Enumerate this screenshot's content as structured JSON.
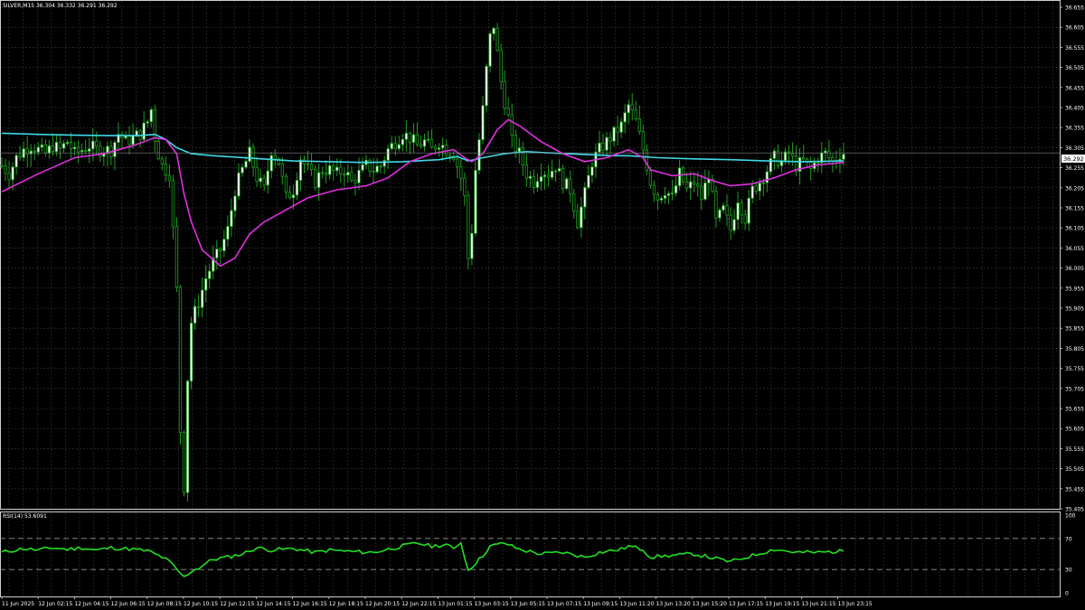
{
  "header": {
    "symbol_line": "SILVER,M15  36.304 36.332 36.291 36.292"
  },
  "rsi_header": {
    "label": "RSI(14) 53.6091"
  },
  "current_price_tag": "36.292",
  "colors": {
    "background": "#000000",
    "grid": "#3a3a3a",
    "axis_text": "#ffffff",
    "bull_candle": "#ffffff",
    "bear_candle": "#000000",
    "candle_outline": "#1f9d1f",
    "ma_fast": "#e030e0",
    "ma_slow": "#40d8e8",
    "rsi_line": "#22e022",
    "level_line": "#9a9a9a"
  },
  "chart_data": [
    {
      "type": "candlestick",
      "title": "SILVER,M15",
      "ylim": [
        35.405,
        36.655
      ],
      "y_ticks": [
        "36.655",
        "36.605",
        "36.555",
        "36.505",
        "36.455",
        "36.405",
        "36.355",
        "36.305",
        "36.255",
        "36.205",
        "36.155",
        "36.105",
        "36.055",
        "36.005",
        "35.955",
        "35.905",
        "35.855",
        "35.805",
        "35.755",
        "35.705",
        "35.655",
        "35.605",
        "35.555",
        "35.505",
        "35.455",
        "35.405"
      ],
      "x_labels": [
        "11 Jun 2025",
        "12 Jun 02:15",
        "12 Jun 04:15",
        "12 Jun 06:15",
        "12 Jun 08:15",
        "12 Jun 10:15",
        "12 Jun 12:15",
        "12 Jun 14:15",
        "12 Jun 16:15",
        "12 Jun 18:15",
        "12 Jun 20:15",
        "12 Jun 22:15",
        "13 Jun 01:15",
        "13 Jun 03:15",
        "13 Jun 05:15",
        "13 Jun 07:15",
        "13 Jun 09:15",
        "13 Jun 11:20",
        "13 Jun 13:20",
        "13 Jun 15:20",
        "13 Jun 17:15",
        "13 Jun 19:15",
        "13 Jun 21:15",
        "13 Jun 23:15"
      ],
      "last_price": 36.292,
      "candle_path": [
        [
          0,
          36.26
        ],
        [
          2,
          36.24
        ],
        [
          4,
          36.28
        ],
        [
          6,
          36.3
        ],
        [
          8,
          36.31
        ],
        [
          10,
          36.3
        ],
        [
          12,
          36.29
        ],
        [
          14,
          36.31
        ],
        [
          16,
          36.3
        ],
        [
          18,
          36.32
        ],
        [
          20,
          36.29
        ],
        [
          22,
          36.3
        ],
        [
          24,
          36.31
        ],
        [
          26,
          36.3
        ],
        [
          28,
          36.3
        ],
        [
          30,
          36.3
        ],
        [
          32,
          36.34
        ],
        [
          34,
          36.32
        ],
        [
          36,
          36.33
        ],
        [
          38,
          36.34
        ],
        [
          40,
          36.37
        ],
        [
          41,
          36.4
        ],
        [
          42,
          36.33
        ],
        [
          43,
          36.29
        ],
        [
          44,
          36.26
        ],
        [
          46,
          36.24
        ],
        [
          47,
          36.1
        ],
        [
          48,
          35.95
        ],
        [
          49,
          35.6
        ],
        [
          50,
          35.46
        ],
        [
          51,
          35.73
        ],
        [
          52,
          35.87
        ],
        [
          54,
          35.92
        ],
        [
          56,
          35.98
        ],
        [
          58,
          36.02
        ],
        [
          60,
          36.05
        ],
        [
          62,
          36.1
        ],
        [
          64,
          36.2
        ],
        [
          66,
          36.25
        ],
        [
          68,
          36.29
        ],
        [
          70,
          36.23
        ],
        [
          72,
          36.2
        ],
        [
          74,
          36.3
        ],
        [
          76,
          36.27
        ],
        [
          78,
          36.18
        ],
        [
          80,
          36.2
        ],
        [
          82,
          36.28
        ],
        [
          84,
          36.25
        ],
        [
          86,
          36.22
        ],
        [
          88,
          36.25
        ],
        [
          90,
          36.25
        ],
        [
          92,
          36.24
        ],
        [
          94,
          36.25
        ],
        [
          96,
          36.22
        ],
        [
          98,
          36.24
        ],
        [
          100,
          36.26
        ],
        [
          102,
          36.25
        ],
        [
          104,
          36.26
        ],
        [
          106,
          36.3
        ],
        [
          108,
          36.32
        ],
        [
          110,
          36.34
        ],
        [
          112,
          36.33
        ],
        [
          114,
          36.31
        ],
        [
          116,
          36.32
        ],
        [
          118,
          36.3
        ],
        [
          120,
          36.32
        ],
        [
          122,
          36.3
        ],
        [
          124,
          36.29
        ],
        [
          125,
          36.26
        ],
        [
          126,
          36.23
        ],
        [
          127,
          36.18
        ],
        [
          128,
          36.03
        ],
        [
          129,
          36.1
        ],
        [
          130,
          36.25
        ],
        [
          132,
          36.4
        ],
        [
          133,
          36.5
        ],
        [
          134,
          36.58
        ],
        [
          135,
          36.61
        ],
        [
          136,
          36.54
        ],
        [
          137,
          36.47
        ],
        [
          138,
          36.42
        ],
        [
          139,
          36.38
        ],
        [
          140,
          36.32
        ],
        [
          142,
          36.29
        ],
        [
          144,
          36.24
        ],
        [
          146,
          36.22
        ],
        [
          148,
          36.25
        ],
        [
          150,
          36.24
        ],
        [
          152,
          36.26
        ],
        [
          154,
          36.22
        ],
        [
          156,
          36.2
        ],
        [
          158,
          36.12
        ],
        [
          160,
          36.19
        ],
        [
          162,
          36.27
        ],
        [
          164,
          36.3
        ],
        [
          166,
          36.32
        ],
        [
          168,
          36.34
        ],
        [
          170,
          36.36
        ],
        [
          172,
          36.41
        ],
        [
          174,
          36.37
        ],
        [
          176,
          36.3
        ],
        [
          178,
          36.22
        ],
        [
          180,
          36.18
        ],
        [
          182,
          36.2
        ],
        [
          184,
          36.18
        ],
        [
          186,
          36.24
        ],
        [
          188,
          36.2
        ],
        [
          190,
          36.22
        ],
        [
          192,
          36.18
        ],
        [
          194,
          36.24
        ],
        [
          196,
          36.12
        ],
        [
          198,
          36.15
        ],
        [
          200,
          36.1
        ],
        [
          202,
          36.18
        ],
        [
          204,
          36.13
        ],
        [
          206,
          36.2
        ],
        [
          208,
          36.22
        ],
        [
          210,
          36.25
        ],
        [
          212,
          36.28
        ],
        [
          214,
          36.27
        ],
        [
          216,
          36.29
        ],
        [
          218,
          36.26
        ],
        [
          220,
          36.27
        ],
        [
          222,
          36.25
        ],
        [
          224,
          36.28
        ],
        [
          226,
          36.29
        ],
        [
          228,
          36.27
        ],
        [
          230,
          36.29
        ],
        [
          231,
          36.292
        ]
      ],
      "ma_slow_path": [
        [
          0,
          36.341
        ],
        [
          10,
          36.338
        ],
        [
          20,
          36.336
        ],
        [
          30,
          36.335
        ],
        [
          38,
          36.335
        ],
        [
          42,
          36.338
        ],
        [
          45,
          36.325
        ],
        [
          48,
          36.305
        ],
        [
          52,
          36.29
        ],
        [
          58,
          36.285
        ],
        [
          70,
          36.278
        ],
        [
          80,
          36.272
        ],
        [
          90,
          36.27
        ],
        [
          100,
          36.268
        ],
        [
          110,
          36.27
        ],
        [
          120,
          36.275
        ],
        [
          125,
          36.283
        ],
        [
          128,
          36.272
        ],
        [
          132,
          36.28
        ],
        [
          138,
          36.29
        ],
        [
          144,
          36.295
        ],
        [
          150,
          36.292
        ],
        [
          160,
          36.288
        ],
        [
          168,
          36.285
        ],
        [
          172,
          36.285
        ],
        [
          180,
          36.28
        ],
        [
          190,
          36.277
        ],
        [
          200,
          36.275
        ],
        [
          210,
          36.272
        ],
        [
          220,
          36.27
        ],
        [
          231,
          36.272
        ]
      ],
      "ma_fast_path": [
        [
          0,
          36.195
        ],
        [
          10,
          36.24
        ],
        [
          20,
          36.28
        ],
        [
          28,
          36.29
        ],
        [
          36,
          36.31
        ],
        [
          42,
          36.33
        ],
        [
          45,
          36.325
        ],
        [
          48,
          36.29
        ],
        [
          50,
          36.19
        ],
        [
          52,
          36.12
        ],
        [
          55,
          36.05
        ],
        [
          60,
          36.01
        ],
        [
          64,
          36.03
        ],
        [
          68,
          36.09
        ],
        [
          72,
          36.12
        ],
        [
          78,
          36.15
        ],
        [
          84,
          36.18
        ],
        [
          92,
          36.2
        ],
        [
          100,
          36.21
        ],
        [
          106,
          36.23
        ],
        [
          112,
          36.27
        ],
        [
          118,
          36.29
        ],
        [
          124,
          36.3
        ],
        [
          127,
          36.28
        ],
        [
          129,
          36.27
        ],
        [
          132,
          36.29
        ],
        [
          136,
          36.35
        ],
        [
          139,
          36.375
        ],
        [
          142,
          36.36
        ],
        [
          148,
          36.32
        ],
        [
          154,
          36.29
        ],
        [
          160,
          36.27
        ],
        [
          166,
          36.28
        ],
        [
          172,
          36.3
        ],
        [
          176,
          36.28
        ],
        [
          178,
          36.25
        ],
        [
          184,
          36.235
        ],
        [
          190,
          36.24
        ],
        [
          196,
          36.22
        ],
        [
          200,
          36.21
        ],
        [
          206,
          36.215
        ],
        [
          212,
          36.23
        ],
        [
          218,
          36.25
        ],
        [
          224,
          36.262
        ],
        [
          231,
          36.268
        ]
      ]
    },
    {
      "type": "line",
      "title": "RSI(14) 53.6091",
      "ylim": [
        0,
        100
      ],
      "y_ticks": [
        "100",
        "70",
        "30",
        "0"
      ],
      "levels": [
        70,
        30
      ],
      "path": [
        [
          0,
          52
        ],
        [
          6,
          57
        ],
        [
          10,
          55
        ],
        [
          14,
          58
        ],
        [
          18,
          56
        ],
        [
          22,
          58
        ],
        [
          26,
          55
        ],
        [
          30,
          58
        ],
        [
          36,
          56
        ],
        [
          40,
          54
        ],
        [
          42,
          50
        ],
        [
          44,
          46
        ],
        [
          46,
          40
        ],
        [
          48,
          30
        ],
        [
          50,
          20
        ],
        [
          52,
          28
        ],
        [
          54,
          32
        ],
        [
          56,
          38
        ],
        [
          58,
          43
        ],
        [
          62,
          46
        ],
        [
          66,
          50
        ],
        [
          70,
          58
        ],
        [
          74,
          55
        ],
        [
          80,
          57
        ],
        [
          86,
          52
        ],
        [
          90,
          55
        ],
        [
          96,
          53
        ],
        [
          102,
          52
        ],
        [
          106,
          56
        ],
        [
          110,
          60
        ],
        [
          114,
          64
        ],
        [
          118,
          60
        ],
        [
          122,
          62
        ],
        [
          124,
          56
        ],
        [
          126,
          66
        ],
        [
          127,
          45
        ],
        [
          128,
          30
        ],
        [
          130,
          38
        ],
        [
          132,
          48
        ],
        [
          134,
          60
        ],
        [
          136,
          62
        ],
        [
          138,
          64
        ],
        [
          142,
          56
        ],
        [
          148,
          50
        ],
        [
          154,
          52
        ],
        [
          160,
          46
        ],
        [
          164,
          52
        ],
        [
          170,
          56
        ],
        [
          172,
          60
        ],
        [
          176,
          56
        ],
        [
          178,
          46
        ],
        [
          184,
          48
        ],
        [
          190,
          50
        ],
        [
          196,
          44
        ],
        [
          200,
          40
        ],
        [
          206,
          48
        ],
        [
          212,
          56
        ],
        [
          218,
          52
        ],
        [
          224,
          52
        ],
        [
          231,
          53.6
        ]
      ]
    }
  ]
}
